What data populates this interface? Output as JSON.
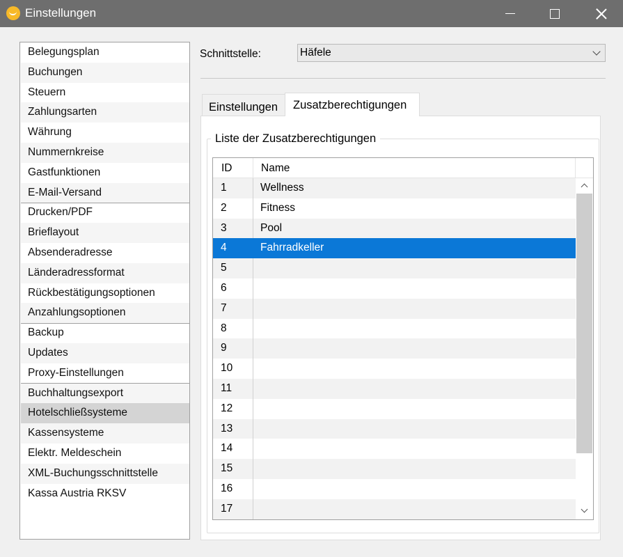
{
  "window": {
    "title": "Einstellungen",
    "icon": "app-logo-icon"
  },
  "sidebar": {
    "items": [
      {
        "label": "Belegungsplan"
      },
      {
        "label": "Buchungen"
      },
      {
        "label": "Steuern"
      },
      {
        "label": "Zahlungsarten"
      },
      {
        "label": "Währung"
      },
      {
        "label": "Nummernkreise"
      },
      {
        "label": "Gastfunktionen"
      },
      {
        "label": "E-Mail-Versand"
      },
      {
        "label": "Drucken/PDF"
      },
      {
        "label": "Brieflayout"
      },
      {
        "label": "Absenderadresse"
      },
      {
        "label": "Länderadressformat"
      },
      {
        "label": "Rückbestätigungsoptionen"
      },
      {
        "label": "Anzahlungsoptionen"
      },
      {
        "label": "Backup"
      },
      {
        "label": "Updates"
      },
      {
        "label": "Proxy-Einstellungen"
      },
      {
        "label": "Buchhaltungsexport"
      },
      {
        "label": "Hotelschließsysteme"
      },
      {
        "label": "Kassensysteme"
      },
      {
        "label": "Elektr. Meldeschein"
      },
      {
        "label": "XML-Buchungsschnittstelle"
      },
      {
        "label": "Kassa Austria RKSV"
      }
    ],
    "selected": "Hotelschließsysteme"
  },
  "schnittstelle": {
    "label": "Schnittstelle:",
    "value": "Häfele"
  },
  "tabs": [
    {
      "label": "Einstellungen",
      "active": false
    },
    {
      "label": "Zusatzberechtigungen",
      "active": true
    }
  ],
  "group": {
    "title": "Liste der Zusatzberechtigungen"
  },
  "table": {
    "columns": [
      "ID",
      "Name"
    ],
    "rows": [
      {
        "id": "1",
        "name": "Wellness"
      },
      {
        "id": "2",
        "name": "Fitness"
      },
      {
        "id": "3",
        "name": "Pool"
      },
      {
        "id": "4",
        "name": "Fahrradkeller"
      },
      {
        "id": "5",
        "name": ""
      },
      {
        "id": "6",
        "name": ""
      },
      {
        "id": "7",
        "name": ""
      },
      {
        "id": "8",
        "name": ""
      },
      {
        "id": "9",
        "name": ""
      },
      {
        "id": "10",
        "name": ""
      },
      {
        "id": "11",
        "name": ""
      },
      {
        "id": "12",
        "name": ""
      },
      {
        "id": "13",
        "name": ""
      },
      {
        "id": "14",
        "name": ""
      },
      {
        "id": "15",
        "name": ""
      },
      {
        "id": "16",
        "name": ""
      },
      {
        "id": "17",
        "name": ""
      }
    ],
    "selected_id": "4"
  },
  "colors": {
    "titlebar": "#6e6e6e",
    "selection": "#0b78d7",
    "sidebar_selected": "#d4d4d4",
    "app_icon": "#f7b928"
  }
}
